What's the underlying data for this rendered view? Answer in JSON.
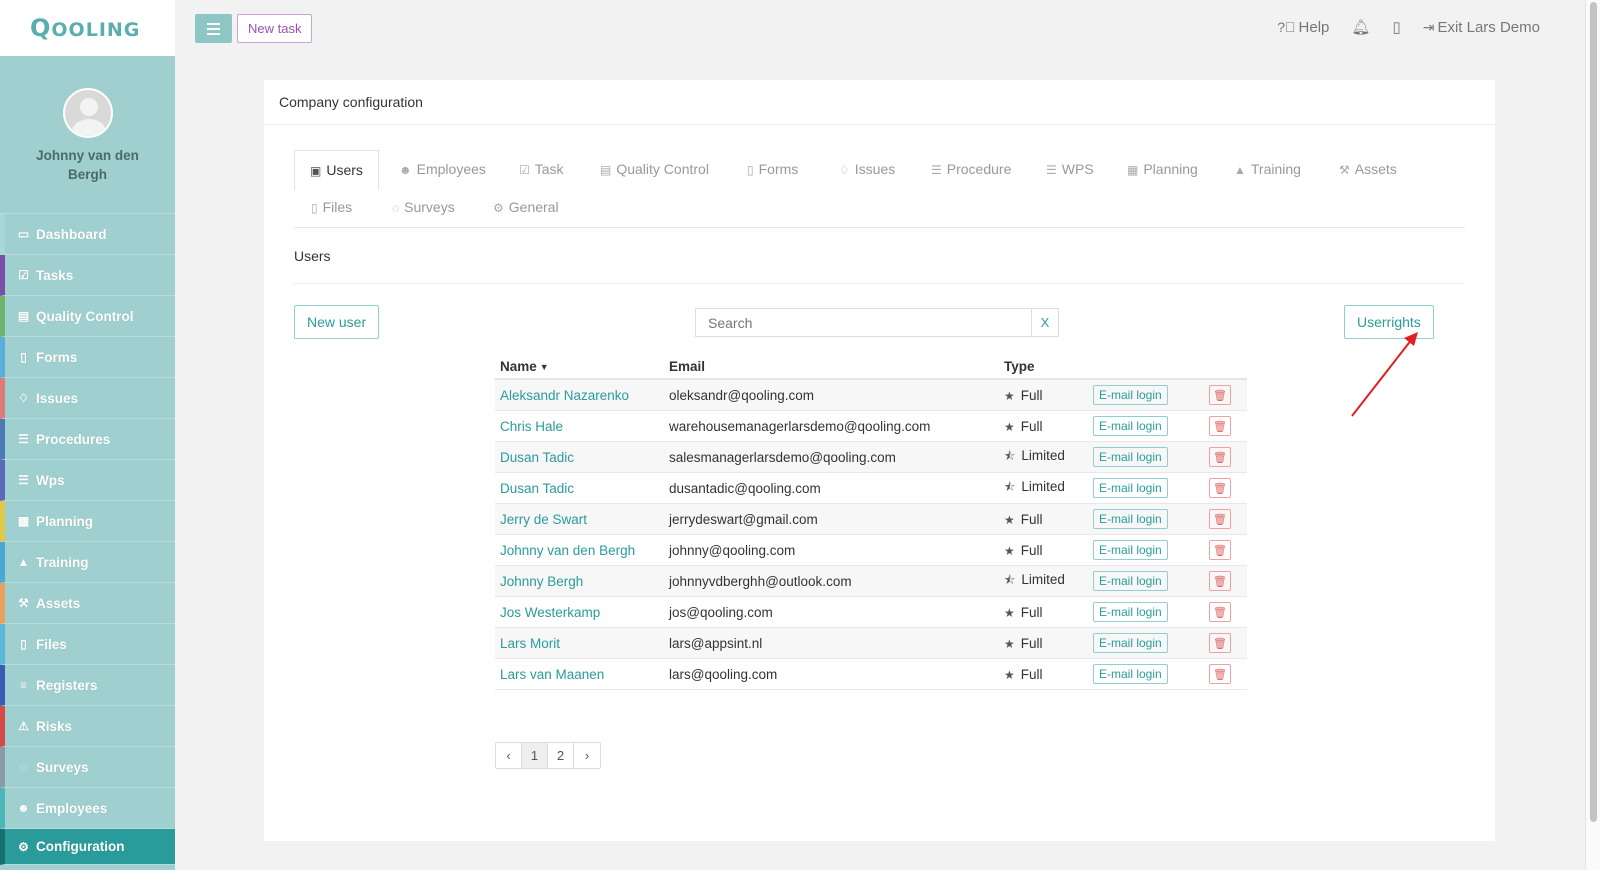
{
  "brand": {
    "logo_big": "Q",
    "logo_rest": "OOLING"
  },
  "colors": {
    "accent": "#2b9b9b",
    "sidebar": "#9fcfcf",
    "new_task": "#9b4fb8",
    "danger": "#e06666",
    "annotation_arrow": "#e02020"
  },
  "profile": {
    "name": "Johnny van den Bergh"
  },
  "sidebar": {
    "items": [
      {
        "label": "Dashboard",
        "icon": "monitor-icon",
        "color": "#a8d8d8"
      },
      {
        "label": "Tasks",
        "icon": "check-square-icon",
        "color": "#7b4fa8"
      },
      {
        "label": "Quality Control",
        "icon": "book-icon",
        "color": "#6cb36c"
      },
      {
        "label": "Forms",
        "icon": "file-icon",
        "color": "#5aaed8"
      },
      {
        "label": "Issues",
        "icon": "bell-icon",
        "color": "#e07a7a"
      },
      {
        "label": "Procedures",
        "icon": "list-icon",
        "color": "#4a7ab8"
      },
      {
        "label": "Wps",
        "icon": "list-icon",
        "color": "#5a6ab8"
      },
      {
        "label": "Planning",
        "icon": "calendar-icon",
        "color": "#e0c84a"
      },
      {
        "label": "Training",
        "icon": "graduation-cap-icon",
        "color": "#4aa8d8"
      },
      {
        "label": "Assets",
        "icon": "wrench-icon",
        "color": "#e8a05a"
      },
      {
        "label": "Files",
        "icon": "file-pdf-icon",
        "color": "#5ab8d8"
      },
      {
        "label": "Registers",
        "icon": "bars-icon",
        "color": "#3a5ab8"
      },
      {
        "label": "Risks",
        "icon": "warning-icon",
        "color": "#d84a4a"
      },
      {
        "label": "Surveys",
        "icon": "comment-icon",
        "color": "#8a9aa8"
      },
      {
        "label": "Employees",
        "icon": "users-icon",
        "color": "#4ab8b8"
      },
      {
        "label": "Configuration",
        "icon": "gear-icon",
        "color": "#176e6e"
      }
    ]
  },
  "topbar": {
    "new_task": "New task",
    "help": "Help",
    "exit": "Exit Lars Demo"
  },
  "panel": {
    "title": "Company configuration",
    "tabs": [
      {
        "label": "Users",
        "icon": "id-card-icon"
      },
      {
        "label": "Employees",
        "icon": "users-icon"
      },
      {
        "label": "Task",
        "icon": "check-square-icon"
      },
      {
        "label": "Quality Control",
        "icon": "book-icon"
      },
      {
        "label": "Forms",
        "icon": "file-icon"
      },
      {
        "label": "Issues",
        "icon": "bell-icon"
      },
      {
        "label": "Procedure",
        "icon": "list-icon"
      },
      {
        "label": "WPS",
        "icon": "list-icon"
      },
      {
        "label": "Planning",
        "icon": "calendar-icon"
      },
      {
        "label": "Training",
        "icon": "graduation-cap-icon"
      },
      {
        "label": "Assets",
        "icon": "wrench-icon"
      },
      {
        "label": "Files",
        "icon": "file-icon"
      },
      {
        "label": "Surveys",
        "icon": "comment-icon"
      },
      {
        "label": "General",
        "icon": "gear-icon"
      }
    ],
    "section_title": "Users",
    "new_user": "New user",
    "search_placeholder": "Search",
    "search_clear": "X",
    "userrights": "Userrights"
  },
  "table": {
    "headers": {
      "name": "Name",
      "email": "Email",
      "type": "Type"
    },
    "login_label": "E-mail login",
    "rows": [
      {
        "name": "Aleksandr Nazarenko",
        "email": "oleksandr@qooling.com",
        "type": "Full"
      },
      {
        "name": "Chris Hale",
        "email": "warehousemanagerlarsdemo@qooling.com",
        "type": "Full"
      },
      {
        "name": "Dusan Tadic",
        "email": "salesmanagerlarsdemo@qooling.com",
        "type": "Limited"
      },
      {
        "name": "Dusan Tadic",
        "email": "dusantadic@qooling.com",
        "type": "Limited"
      },
      {
        "name": "Jerry de Swart",
        "email": "jerrydeswart@gmail.com",
        "type": "Full"
      },
      {
        "name": "Johnny van den Bergh",
        "email": "johnny@qooling.com",
        "type": "Full"
      },
      {
        "name": "Johnny Bergh",
        "email": "johnnyvdberghh@outlook.com",
        "type": "Limited"
      },
      {
        "name": "Jos Westerkamp",
        "email": "jos@qooling.com",
        "type": "Full"
      },
      {
        "name": "Lars Morit",
        "email": "lars@appsint.nl",
        "type": "Full"
      },
      {
        "name": "Lars van Maanen",
        "email": "lars@qooling.com",
        "type": "Full"
      }
    ]
  },
  "pagination": {
    "prev": "‹",
    "pages": [
      "1",
      "2"
    ],
    "current": "1",
    "next": "›"
  }
}
